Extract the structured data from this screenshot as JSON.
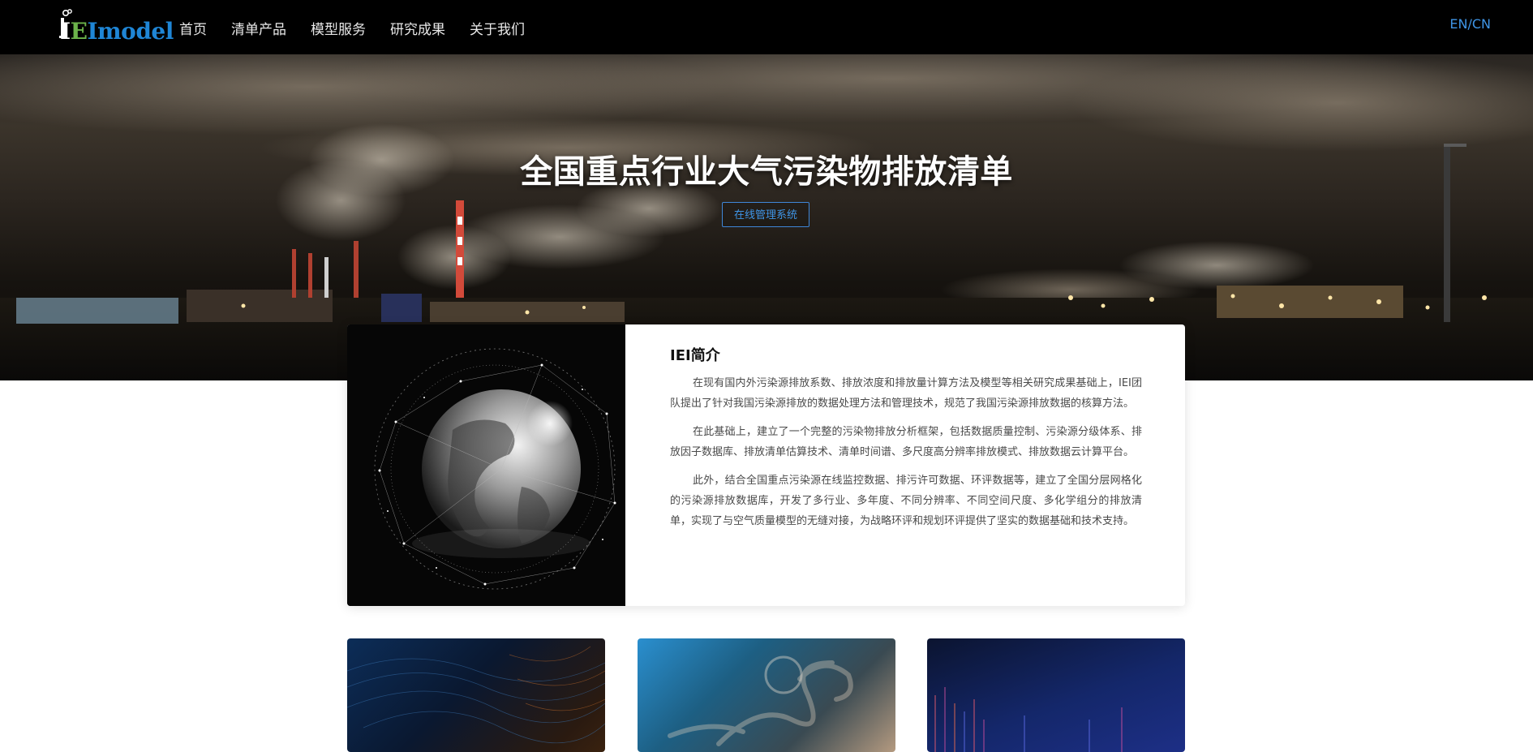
{
  "header": {
    "logo": {
      "text_prefix": "I",
      "text_mid": "E",
      "text_suffix": "Imodel",
      "icon": "factory-logo-icon"
    },
    "nav": [
      "首页",
      "清单产品",
      "模型服务",
      "研究成果",
      "关于我们"
    ],
    "lang": "EN/CN"
  },
  "hero": {
    "title": "全国重点行业大气污染物排放清单",
    "button": "在线管理系统",
    "background": "industrial-night-smokestacks-image"
  },
  "intro": {
    "image": "wireframe-globe-image",
    "title": "IEI简介",
    "paragraphs": [
      "在现有国内外污染源排放系数、排放浓度和排放量计算方法及模型等相关研究成果基础上，IEI团队提出了针对我国污染源排放的数据处理方法和管理技术，规范了我国污染源排放数据的核算方法。",
      "在此基础上，建立了一个完整的污染物排放分析框架，包括数据质量控制、污染源分级体系、排放因子数据库、排放清单估算技术、清单时间谱、多尺度高分辨率排放模式、排放数据云计算平台。",
      "此外，结合全国重点污染源在线监控数据、排污许可数据、环评数据等，建立了全国分层网格化的污染源排放数据库，开发了多行业、多年度、不同分辨率、不同空间尺度、多化学组分的排放清单，实现了与空气质量模型的无缝对接，为战略环评和规划环评提供了坚实的数据基础和技术支持。"
    ]
  },
  "feature_cards": [
    {
      "image": "contour-lines-image"
    },
    {
      "image": "swirl-particles-image"
    },
    {
      "image": "data-streams-image"
    }
  ],
  "colors": {
    "header_bg": "#000000",
    "accent": "#3f95e6",
    "logo_green": "#6cb34a",
    "logo_blue": "#1f86d6"
  }
}
